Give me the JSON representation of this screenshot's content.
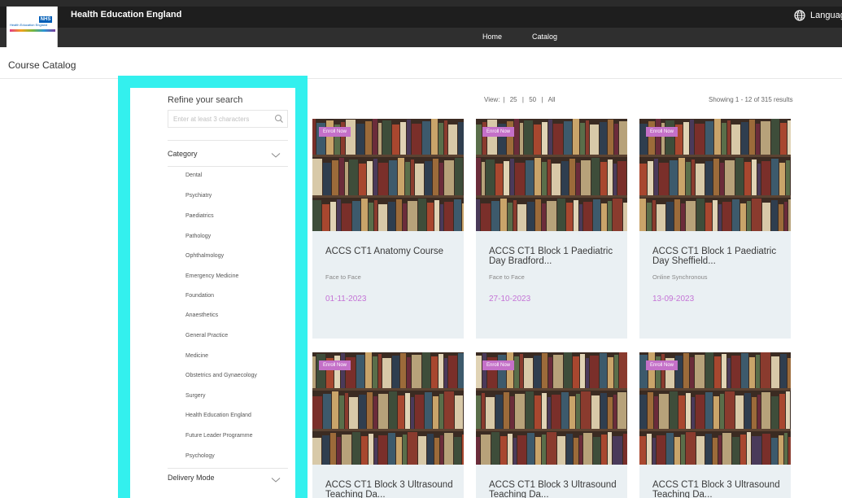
{
  "header": {
    "logo_text": "Health Education England",
    "logo_badge": "NHS",
    "brand": "Health Education England",
    "language": "Language",
    "nav": [
      "Home",
      "Catalog"
    ]
  },
  "page_title": "Course Catalog",
  "sidebar": {
    "refine": "Refine your search",
    "search_placeholder": "Enter at least 3 characters",
    "category_label": "Category",
    "categories": [
      "Dental",
      "Psychiatry",
      "Paediatrics",
      "Pathology",
      "Ophthalmology",
      "Emergency Medicine",
      "Foundation",
      "Anaesthetics",
      "General Practice",
      "Medicine",
      "Obstetrics and Gynaecology",
      "Surgery",
      "Health Education England",
      "Future Leader Programme",
      "Psychology"
    ],
    "delivery_mode_label": "Delivery Mode"
  },
  "toolbar": {
    "view_label": "View:",
    "view_options": [
      "25",
      "50",
      "All"
    ],
    "separator": "|",
    "showing": "Showing 1 - 12 of 315 results"
  },
  "cards": [
    {
      "badge": "Enroll Now",
      "title": "ACCS CT1 Anatomy Course",
      "mode": "Face to Face",
      "date": "01-11-2023"
    },
    {
      "badge": "Enroll Now",
      "title": "ACCS CT1 Block 1 Paediatric Day Bradford...",
      "mode": "Face to Face",
      "date": "27-10-2023"
    },
    {
      "badge": "Enroll Now",
      "title": "ACCS CT1 Block 1 Paediatric Day Sheffield...",
      "mode": "Online Synchronous",
      "date": "13-09-2023"
    },
    {
      "badge": "Enroll Now",
      "title": "ACCS CT1 Block 3 Ultrasound Teaching Da...",
      "mode": "",
      "date": ""
    },
    {
      "badge": "Enroll Now",
      "title": "ACCS CT1 Block 3 Ultrasound Teaching Da...",
      "mode": "",
      "date": ""
    },
    {
      "badge": "Enroll Now",
      "title": "ACCS CT1 Block 3 Ultrasound Teaching Da...",
      "mode": "",
      "date": ""
    }
  ],
  "colors": {
    "topbar": "#1e1e1e",
    "highlight_frame": "#33f0ee",
    "badge": "#c470c8",
    "date": "#c473d6",
    "card_bg": "#eaf0f3"
  }
}
